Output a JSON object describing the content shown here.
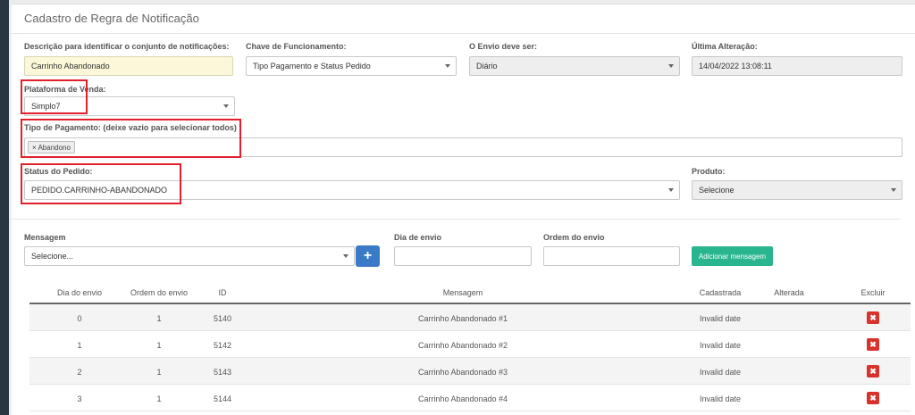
{
  "title": "Cadastro de Regra de Notificação",
  "form": {
    "descricao_label": "Descrição para identificar o conjunto de notificações:",
    "descricao_value": "Carrinho Abandonado",
    "chave_label": "Chave de Funcionamento:",
    "chave_value": "Tipo Pagamento e Status Pedido",
    "envio_label": "O Envio deve ser:",
    "envio_value": "Diário",
    "ultima_label": "Última Alteração:",
    "ultima_value": "14/04/2022 13:08:11",
    "plataforma_label": "Plataforma de Venda:",
    "plataforma_value": "Simplo7",
    "tipo_pagamento_label": "Tipo de Pagamento: (deixe vazio para selecionar todos)",
    "tipo_pagamento_tag": "× Abandono",
    "status_label": "Status do Pedido:",
    "status_value": "PEDIDO.CARRINHO-ABANDONADO",
    "produto_label": "Produto:",
    "produto_value": "Selecione"
  },
  "mensagem": {
    "label": "Mensagem",
    "value": "Selecione...",
    "plus_label": "+",
    "dia_label": "Dia de envio",
    "dia_value": "",
    "ordem_label": "Ordem do envio",
    "ordem_value": "",
    "add_label": "Adicionar mensagem"
  },
  "table": {
    "headers": [
      "Dia do envio",
      "Ordem do envio",
      "ID",
      "Mensagem",
      "Cadastrada",
      "Alterada",
      "Excluir"
    ],
    "rows": [
      {
        "dia": "0",
        "ordem": "1",
        "id": "5140",
        "mensagem": "Carrinho Abandonado #1",
        "cadastrada": "Invalid date",
        "alterada": ""
      },
      {
        "dia": "1",
        "ordem": "1",
        "id": "5142",
        "mensagem": "Carrinho Abandonado #2",
        "cadastrada": "Invalid date",
        "alterada": ""
      },
      {
        "dia": "2",
        "ordem": "1",
        "id": "5143",
        "mensagem": "Carrinho Abandonado #3",
        "cadastrada": "Invalid date",
        "alterada": ""
      },
      {
        "dia": "3",
        "ordem": "1",
        "id": "5144",
        "mensagem": "Carrinho Abandonado #4",
        "cadastrada": "Invalid date",
        "alterada": ""
      }
    ],
    "delete_glyph": "✖"
  },
  "colors": {
    "highlight": "#e0202a",
    "primary": "#3a7bc8",
    "success": "#29b68f",
    "danger": "#d9312b"
  }
}
